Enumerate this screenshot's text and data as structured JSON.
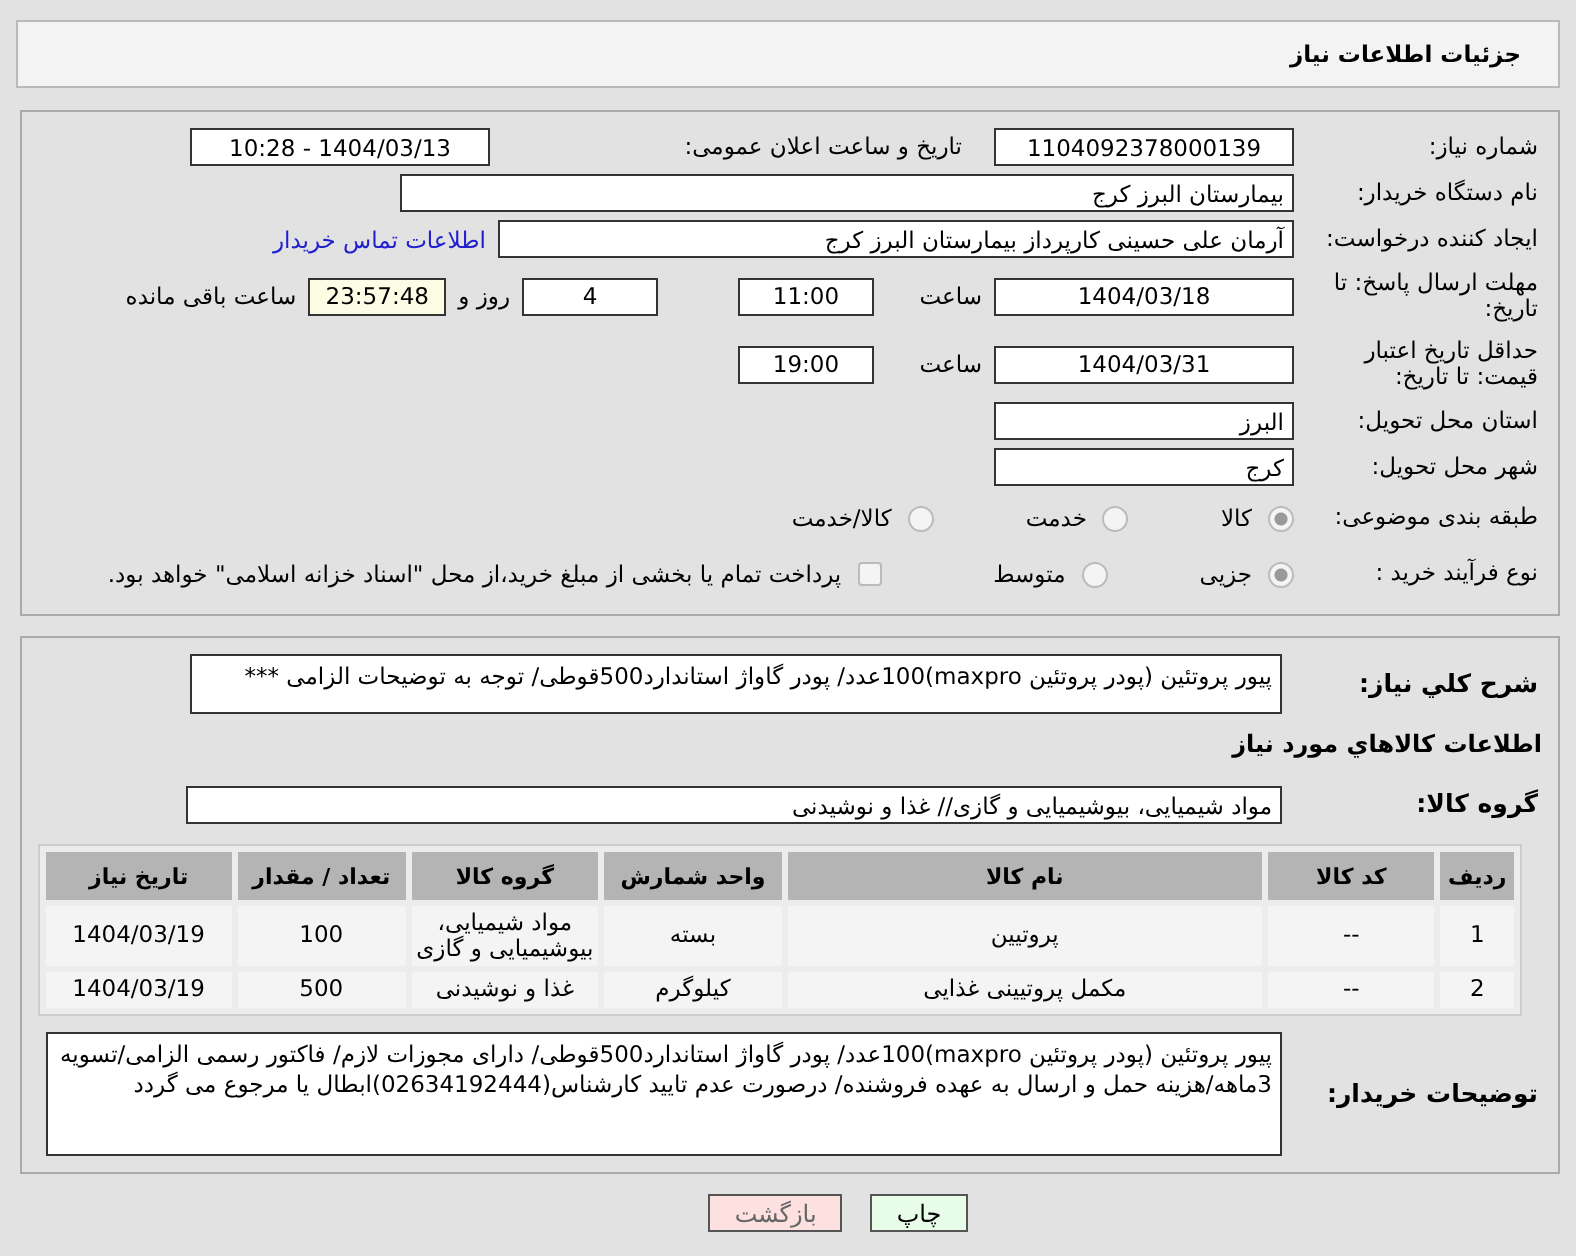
{
  "header": {
    "title": "جزئیات اطلاعات نیاز"
  },
  "need_number": {
    "label": "شماره نیاز:",
    "value": "1104092378000139"
  },
  "announce": {
    "label": "تاریخ و ساعت اعلان عمومی:",
    "value": "1404/03/13 - 10:28"
  },
  "buyer_org": {
    "label": "نام دستگاه خریدار:",
    "value": "بیمارستان البرز کرج"
  },
  "requester": {
    "label": "ایجاد کننده درخواست:",
    "value": "آرمان علی حسینی کارپرداز بیمارستان البرز کرج",
    "link": "اطلاعات تماس خریدار"
  },
  "deadline": {
    "label": "مهلت ارسال پاسخ: تا تاریخ:",
    "date": "1404/03/18",
    "time_label": "ساعت",
    "time": "11:00",
    "days": "4",
    "days_label": "روز و",
    "remaining": "23:57:48",
    "remaining_label": "ساعت باقی مانده"
  },
  "price_validity": {
    "label": "حداقل تاریخ اعتبار قیمت: تا تاریخ:",
    "date": "1404/03/31",
    "time_label": "ساعت",
    "time": "19:00"
  },
  "province": {
    "label": "استان محل تحویل:",
    "value": "البرز"
  },
  "city": {
    "label": "شهر محل تحویل:",
    "value": "کرج"
  },
  "category": {
    "label": "طبقه بندی موضوعی:",
    "options": [
      {
        "label": "کالا",
        "selected": true
      },
      {
        "label": "خدمت",
        "selected": false
      },
      {
        "label": "کالا/خدمت",
        "selected": false
      }
    ]
  },
  "process": {
    "label": "نوع فرآیند خرید :",
    "options": [
      {
        "label": "جزیی",
        "selected": true
      },
      {
        "label": "متوسط",
        "selected": false
      }
    ],
    "treasury": {
      "label": "پرداخت تمام یا بخشی از مبلغ خرید،از محل \"اسناد خزانه اسلامی\" خواهد بود.",
      "checked": false
    }
  },
  "description": {
    "label": "شرح کلي نیاز:",
    "value": "پیور پروتئین (پودر پروتئین maxpro)100عدد/ پودر گاواژ استاندارد500قوطی/ توجه به توضیحات الزامی ***"
  },
  "goods_heading": "اطلاعات کالاهاي مورد نیاز",
  "goods_group": {
    "label": "گروه کالا:",
    "value": "مواد شیمیایی، بیوشیمیایی و  گازی// غذا و نوشیدنی"
  },
  "table": {
    "columns": [
      "ردیف",
      "کد کالا",
      "نام کالا",
      "واحد شمارش",
      "گروه کالا",
      "تعداد / مقدار",
      "تاریخ نیاز"
    ],
    "rows": [
      [
        "1",
        "--",
        "پروتیین",
        "بسته",
        "مواد شیمیایی، بیوشیمیایی و گازی",
        "100",
        "1404/03/19"
      ],
      [
        "2",
        "--",
        "مکمل پروتیینی غذایی",
        "کیلوگرم",
        "غذا و نوشیدنی",
        "500",
        "1404/03/19"
      ]
    ]
  },
  "buyer_notes": {
    "label": "توضیحات خریدار:",
    "value": "پیور پروتئین (پودر پروتئین maxpro)100عدد/ پودر گاواژ استاندارد500قوطی/ دارای مجوزات لازم/ فاکتور رسمی الزامی/تسویه 3ماهه/هزینه حمل و ارسال به عهده فروشنده/ درصورت عدم تایید کارشناس(02634192444)ابطال یا مرجوع می گردد"
  },
  "buttons": [
    {
      "label": "چاپ",
      "kind": "print"
    },
    {
      "label": "بازگشت",
      "kind": "back"
    }
  ]
}
